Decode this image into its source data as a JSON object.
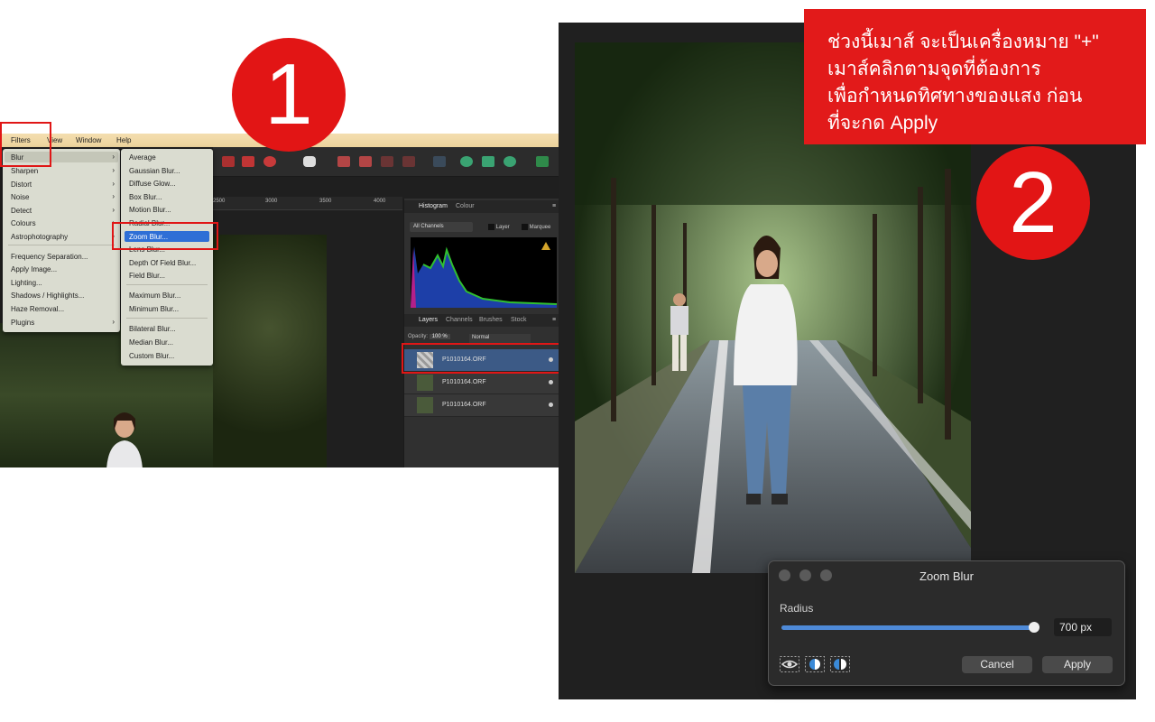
{
  "step1": {
    "badge": "1",
    "menubar": [
      "Filters",
      "View",
      "Window",
      "Help"
    ],
    "filters_menu": [
      {
        "label": "Blur",
        "submenu": true
      },
      {
        "label": "Sharpen",
        "submenu": true
      },
      {
        "label": "Distort",
        "submenu": true
      },
      {
        "label": "Noise",
        "submenu": true
      },
      {
        "label": "Detect",
        "submenu": true
      },
      {
        "label": "Colours",
        "submenu": true
      },
      {
        "label": "Astrophotography",
        "submenu": true
      },
      {
        "label": "Frequency Separation...",
        "submenu": false
      },
      {
        "label": "Apply Image...",
        "submenu": false
      },
      {
        "label": "Lighting...",
        "submenu": false
      },
      {
        "label": "Shadows / Highlights...",
        "submenu": false
      },
      {
        "label": "Haze Removal...",
        "submenu": false
      },
      {
        "label": "Plugins",
        "submenu": true
      }
    ],
    "blur_submenu": [
      "Average",
      "Gaussian Blur...",
      "Diffuse Glow...",
      "Box Blur...",
      "Motion Blur...",
      "Radial Blur...",
      "Zoom Blur...",
      "Lens Blur...",
      "Depth Of Field Blur...",
      "Field Blur...",
      "Maximum Blur...",
      "Minimum Blur...",
      "Bilateral Blur...",
      "Median Blur...",
      "Custom Blur..."
    ],
    "selected_submenu_item": "Zoom Blur...",
    "ruler_ticks": [
      "2500",
      "3000",
      "3500",
      "4000"
    ],
    "histogram": {
      "tabs": [
        "Histogram",
        "Colour"
      ],
      "channel": "All Channels",
      "layer_option": "Layer",
      "marquee_option": "Marquee",
      "warning_icon": "warning-triangle-icon"
    },
    "layers_panel": {
      "tabs": [
        "Layers",
        "Channels",
        "Brushes",
        "Stock"
      ],
      "opacity_label": "Opacity:",
      "opacity_value": "100 %",
      "blend_mode": "Normal",
      "layers": [
        "P1010164.ORF",
        "P1010164.ORF",
        "P1010164.ORF"
      ],
      "selected_index": 0
    }
  },
  "step2": {
    "badge": "2",
    "note_lines": [
      "ช่วงนี้เมาส์ จะเป็นเครื่องหมาย \"+\"",
      "เมาส์คลิกตามจุดที่ต้องการ",
      "เพื่อกำหนดทิศทางของแสง ก่อน",
      "ที่จะกด Apply"
    ],
    "dialog": {
      "title": "Zoom Blur",
      "radius_label": "Radius",
      "radius_value": "700 px",
      "radius_fraction": 0.98,
      "cancel_label": "Cancel",
      "apply_label": "Apply",
      "icons": [
        "eye-preview-icon",
        "split-view-icon",
        "mirror-view-icon"
      ]
    }
  },
  "colors": {
    "highlight_red": "#e21515",
    "menu_selection": "#2f6fd6",
    "selected_layer": "#3c5a86"
  }
}
